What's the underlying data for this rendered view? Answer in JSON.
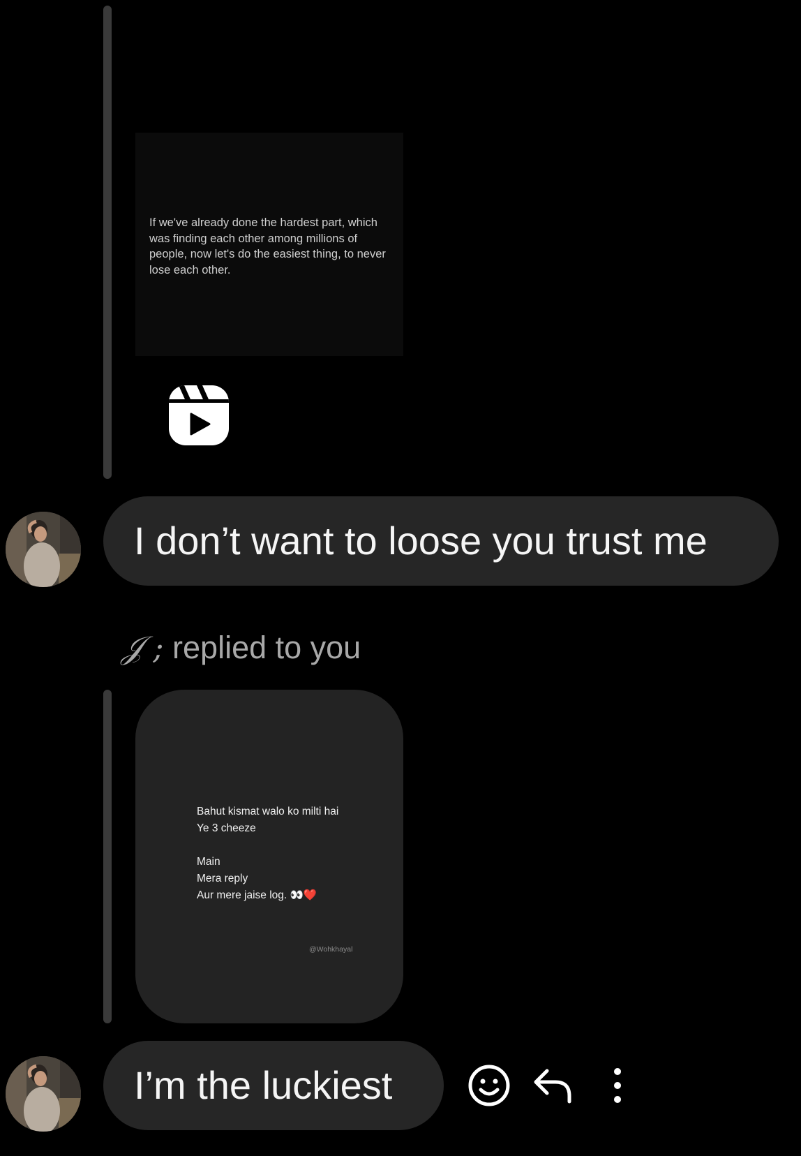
{
  "messages": {
    "shared_reel_1": {
      "quote": "If we've already done the hardest part, which was finding each other among millions of people, now let's do the easiest thing, to never lose each other.",
      "icon": "reels-icon"
    },
    "message_1": {
      "text": "I don’t want to loose you trust me"
    },
    "reply_context": {
      "sender": "𝒥 ;",
      "label": "replied to you"
    },
    "shared_post_2": {
      "lines": [
        "Bahut kismat walo ko milti hai",
        "Ye 3 cheeze",
        "",
        "Main",
        "Mera reply",
        "Aur mere jaise log. 👀❤️"
      ],
      "watermark": "@Wohkhayal"
    },
    "message_2": {
      "text": "I’m the luckiest"
    }
  },
  "message_actions": {
    "react_icon": "smiley-face-icon",
    "reply_icon": "reply-arrow-icon",
    "more_icon": "more-vertical-icon"
  },
  "colors": {
    "background": "#000000",
    "bubble": "#262626",
    "reply_bar": "#3a3a3a",
    "post_card": "#232323",
    "text_primary": "#f5f5f5",
    "text_secondary": "#a8a8a8"
  }
}
